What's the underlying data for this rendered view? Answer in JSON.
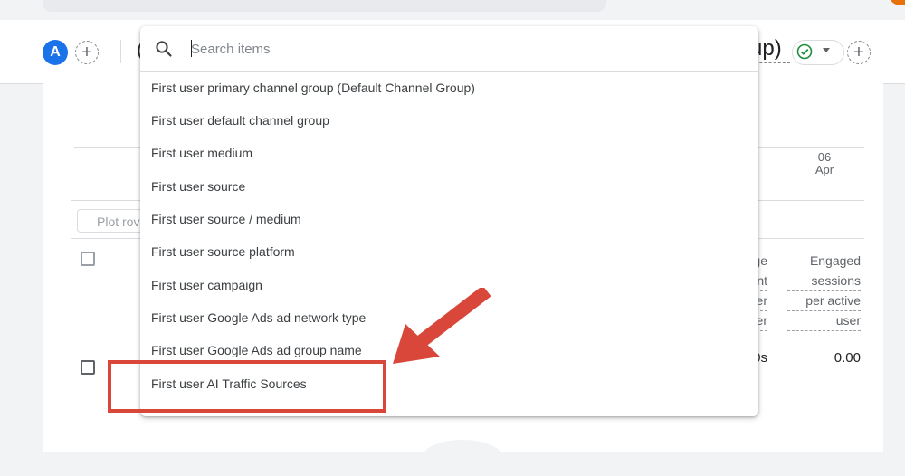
{
  "header": {
    "segment_avatar_letter": "A",
    "add_icon_glyph": "+",
    "cut_left_text": "(",
    "group_text": "up)",
    "icons": [
      "add-icon",
      "check-circle-icon",
      "caret-down-icon"
    ]
  },
  "chart": {
    "date_day": "06",
    "date_month": "Apr"
  },
  "table": {
    "plot_rows_label": "Plot rov",
    "columns": [
      {
        "lines": [
          "ge",
          "nt",
          "er",
          "er"
        ]
      },
      {
        "lines": [
          "Engaged",
          "sessions",
          "per active",
          "user"
        ]
      }
    ],
    "row": {
      "cut_value": "0s",
      "value": "0.00"
    }
  },
  "dropdown": {
    "search": {
      "placeholder": "Search items",
      "value": ""
    },
    "search_icon": "search-icon",
    "options": [
      {
        "label": "First user primary channel group (Default Channel Group)"
      },
      {
        "label": "First user default channel group"
      },
      {
        "label": "First user medium"
      },
      {
        "label": "First user source"
      },
      {
        "label": "First user source / medium"
      },
      {
        "label": "First user source platform"
      },
      {
        "label": "First user campaign"
      },
      {
        "label": "First user Google Ads ad network type"
      },
      {
        "label": "First user Google Ads ad group name"
      },
      {
        "label": "First user AI Traffic Sources"
      }
    ]
  },
  "annotation": {
    "color": "#d8473a",
    "highlighted_option": "First user AI Traffic Sources"
  },
  "colors": {
    "accent_blue": "#1a73e8",
    "check_green": "#1e8e3e",
    "annotation_red": "#d8473a"
  }
}
